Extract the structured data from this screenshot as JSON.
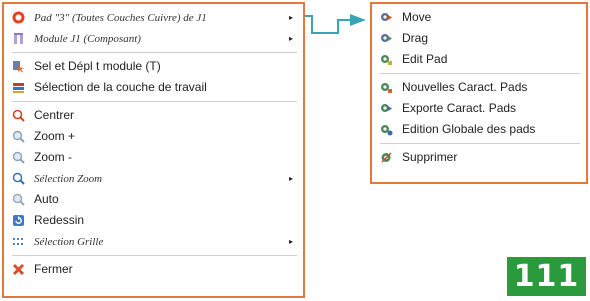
{
  "left_menu": {
    "items": [
      {
        "label": "Pad \"3\" (Toutes Couches Cuivre) de J1",
        "icon": "pad-ring-icon",
        "submenu": true
      },
      {
        "label": "Module J1 (Composant)",
        "icon": "module-icon",
        "submenu": true
      },
      {
        "label": "Sel et Dépl t module (T)",
        "icon": "move-module-icon"
      },
      {
        "label": "Sélection de la couche de travail",
        "icon": "layer-select-icon"
      },
      {
        "label": "Centrer",
        "icon": "center-zoom-icon"
      },
      {
        "label": "Zoom +",
        "icon": "zoom-in-icon"
      },
      {
        "label": "Zoom -",
        "icon": "zoom-out-icon"
      },
      {
        "label": "Sélection Zoom",
        "icon": "zoom-select-icon",
        "submenu": true
      },
      {
        "label": "Auto",
        "icon": "zoom-auto-icon"
      },
      {
        "label": "Redessin",
        "icon": "redraw-icon"
      },
      {
        "label": "Sélection Grille",
        "icon": "grid-icon",
        "submenu": true
      },
      {
        "label": "Fermer",
        "icon": "close-icon"
      }
    ],
    "submenu_arrow": "▸"
  },
  "right_menu": {
    "items": [
      {
        "label": "Move",
        "icon": "pad-move-icon"
      },
      {
        "label": "Drag",
        "icon": "pad-drag-icon"
      },
      {
        "label": "Edit Pad",
        "icon": "pad-edit-icon"
      },
      {
        "label": "Nouvelles Caract. Pads",
        "icon": "pad-new-settings-icon"
      },
      {
        "label": "Exporte Caract. Pads",
        "icon": "pad-export-icon"
      },
      {
        "label": "Edition Globale des pads",
        "icon": "pad-global-edit-icon"
      },
      {
        "label": "Supprimer",
        "icon": "pad-delete-icon"
      }
    ]
  },
  "badge": "111",
  "colors": {
    "menu_border": "#e07a3c",
    "connector": "#3aa3b5",
    "badge_bg": "#2a9a3c"
  }
}
